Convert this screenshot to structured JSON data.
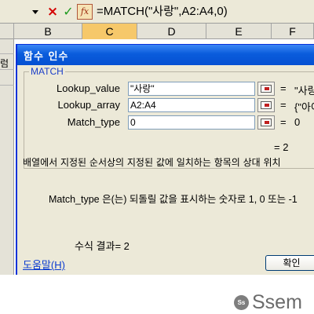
{
  "formula_bar": {
    "dropdown_icon": "chevron-down-icon",
    "cancel_glyph": "×",
    "enter_glyph": "✓",
    "fx_label": "fx",
    "formula": "=MATCH(\"사랑\",A2:A4,0)"
  },
  "sheet": {
    "columns": [
      "B",
      "C",
      "D",
      "E",
      "F"
    ],
    "active_column": "C",
    "cell_fragment": "럼"
  },
  "dialog": {
    "title": "함수 인수",
    "function_name": "MATCH",
    "args": [
      {
        "label": "Lookup_value",
        "value": "\"사랑\"",
        "result": "\"사랑\""
      },
      {
        "label": "Lookup_array",
        "value": "A2:A4",
        "result": "{\"아이"
      },
      {
        "label": "Match_type",
        "value": "0",
        "result": "0"
      }
    ],
    "equals_sign": "=",
    "overall_result": "= 2",
    "description": "배열에서 지정된 순서상의 지정된 값에 일치하는 항목의 상대 위치 ",
    "arg_description": "Match_type 은(는) 되돌릴 값을 표시하는 숫자로 1, 0 또는 -1",
    "formula_result": "수식 결과= 2",
    "help_link": "도움말(H)",
    "ok_label": "확인"
  },
  "watermark": {
    "badge": "Ss",
    "text": "Ssem"
  },
  "colors": {
    "title_bar": "#0a5cdc",
    "dialog_bg": "#ece9d8",
    "active_column": "#f6c86a",
    "link": "#0b3bd0"
  }
}
